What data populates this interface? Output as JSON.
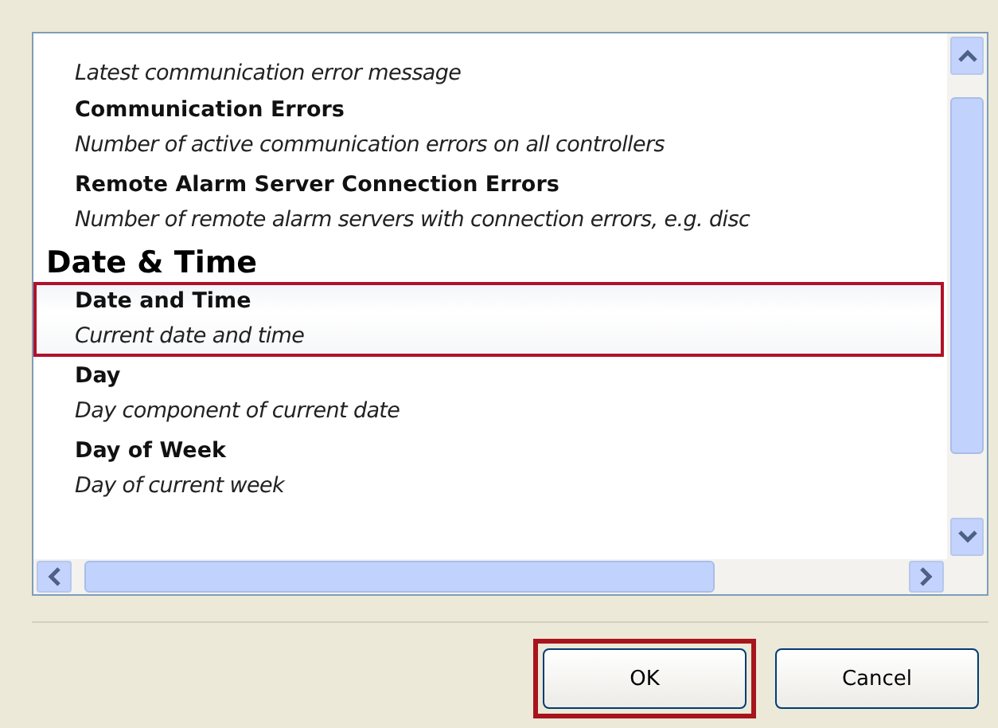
{
  "list": {
    "groups": [
      {
        "items": [
          {
            "title": "Latest communication error message",
            "kind": "description"
          },
          {
            "title": "Communication Errors",
            "description": "Number of active communication errors on all controllers",
            "selected": false
          },
          {
            "title": "Remote Alarm Server Connection Errors",
            "description": "Number of remote alarm servers with connection errors, e.g. disc",
            "selected": false
          }
        ]
      },
      {
        "header": "Date & Time",
        "items": [
          {
            "title": "Date and Time",
            "description": "Current date and time",
            "selected": true
          },
          {
            "title": "Day",
            "description": "Day component of current date",
            "selected": false
          },
          {
            "title": "Day of Week",
            "description": "Day of current week",
            "selected": false
          }
        ]
      }
    ]
  },
  "buttons": [
    {
      "label": "OK",
      "highlighted": true
    },
    {
      "label": "Cancel",
      "highlighted": false
    }
  ]
}
